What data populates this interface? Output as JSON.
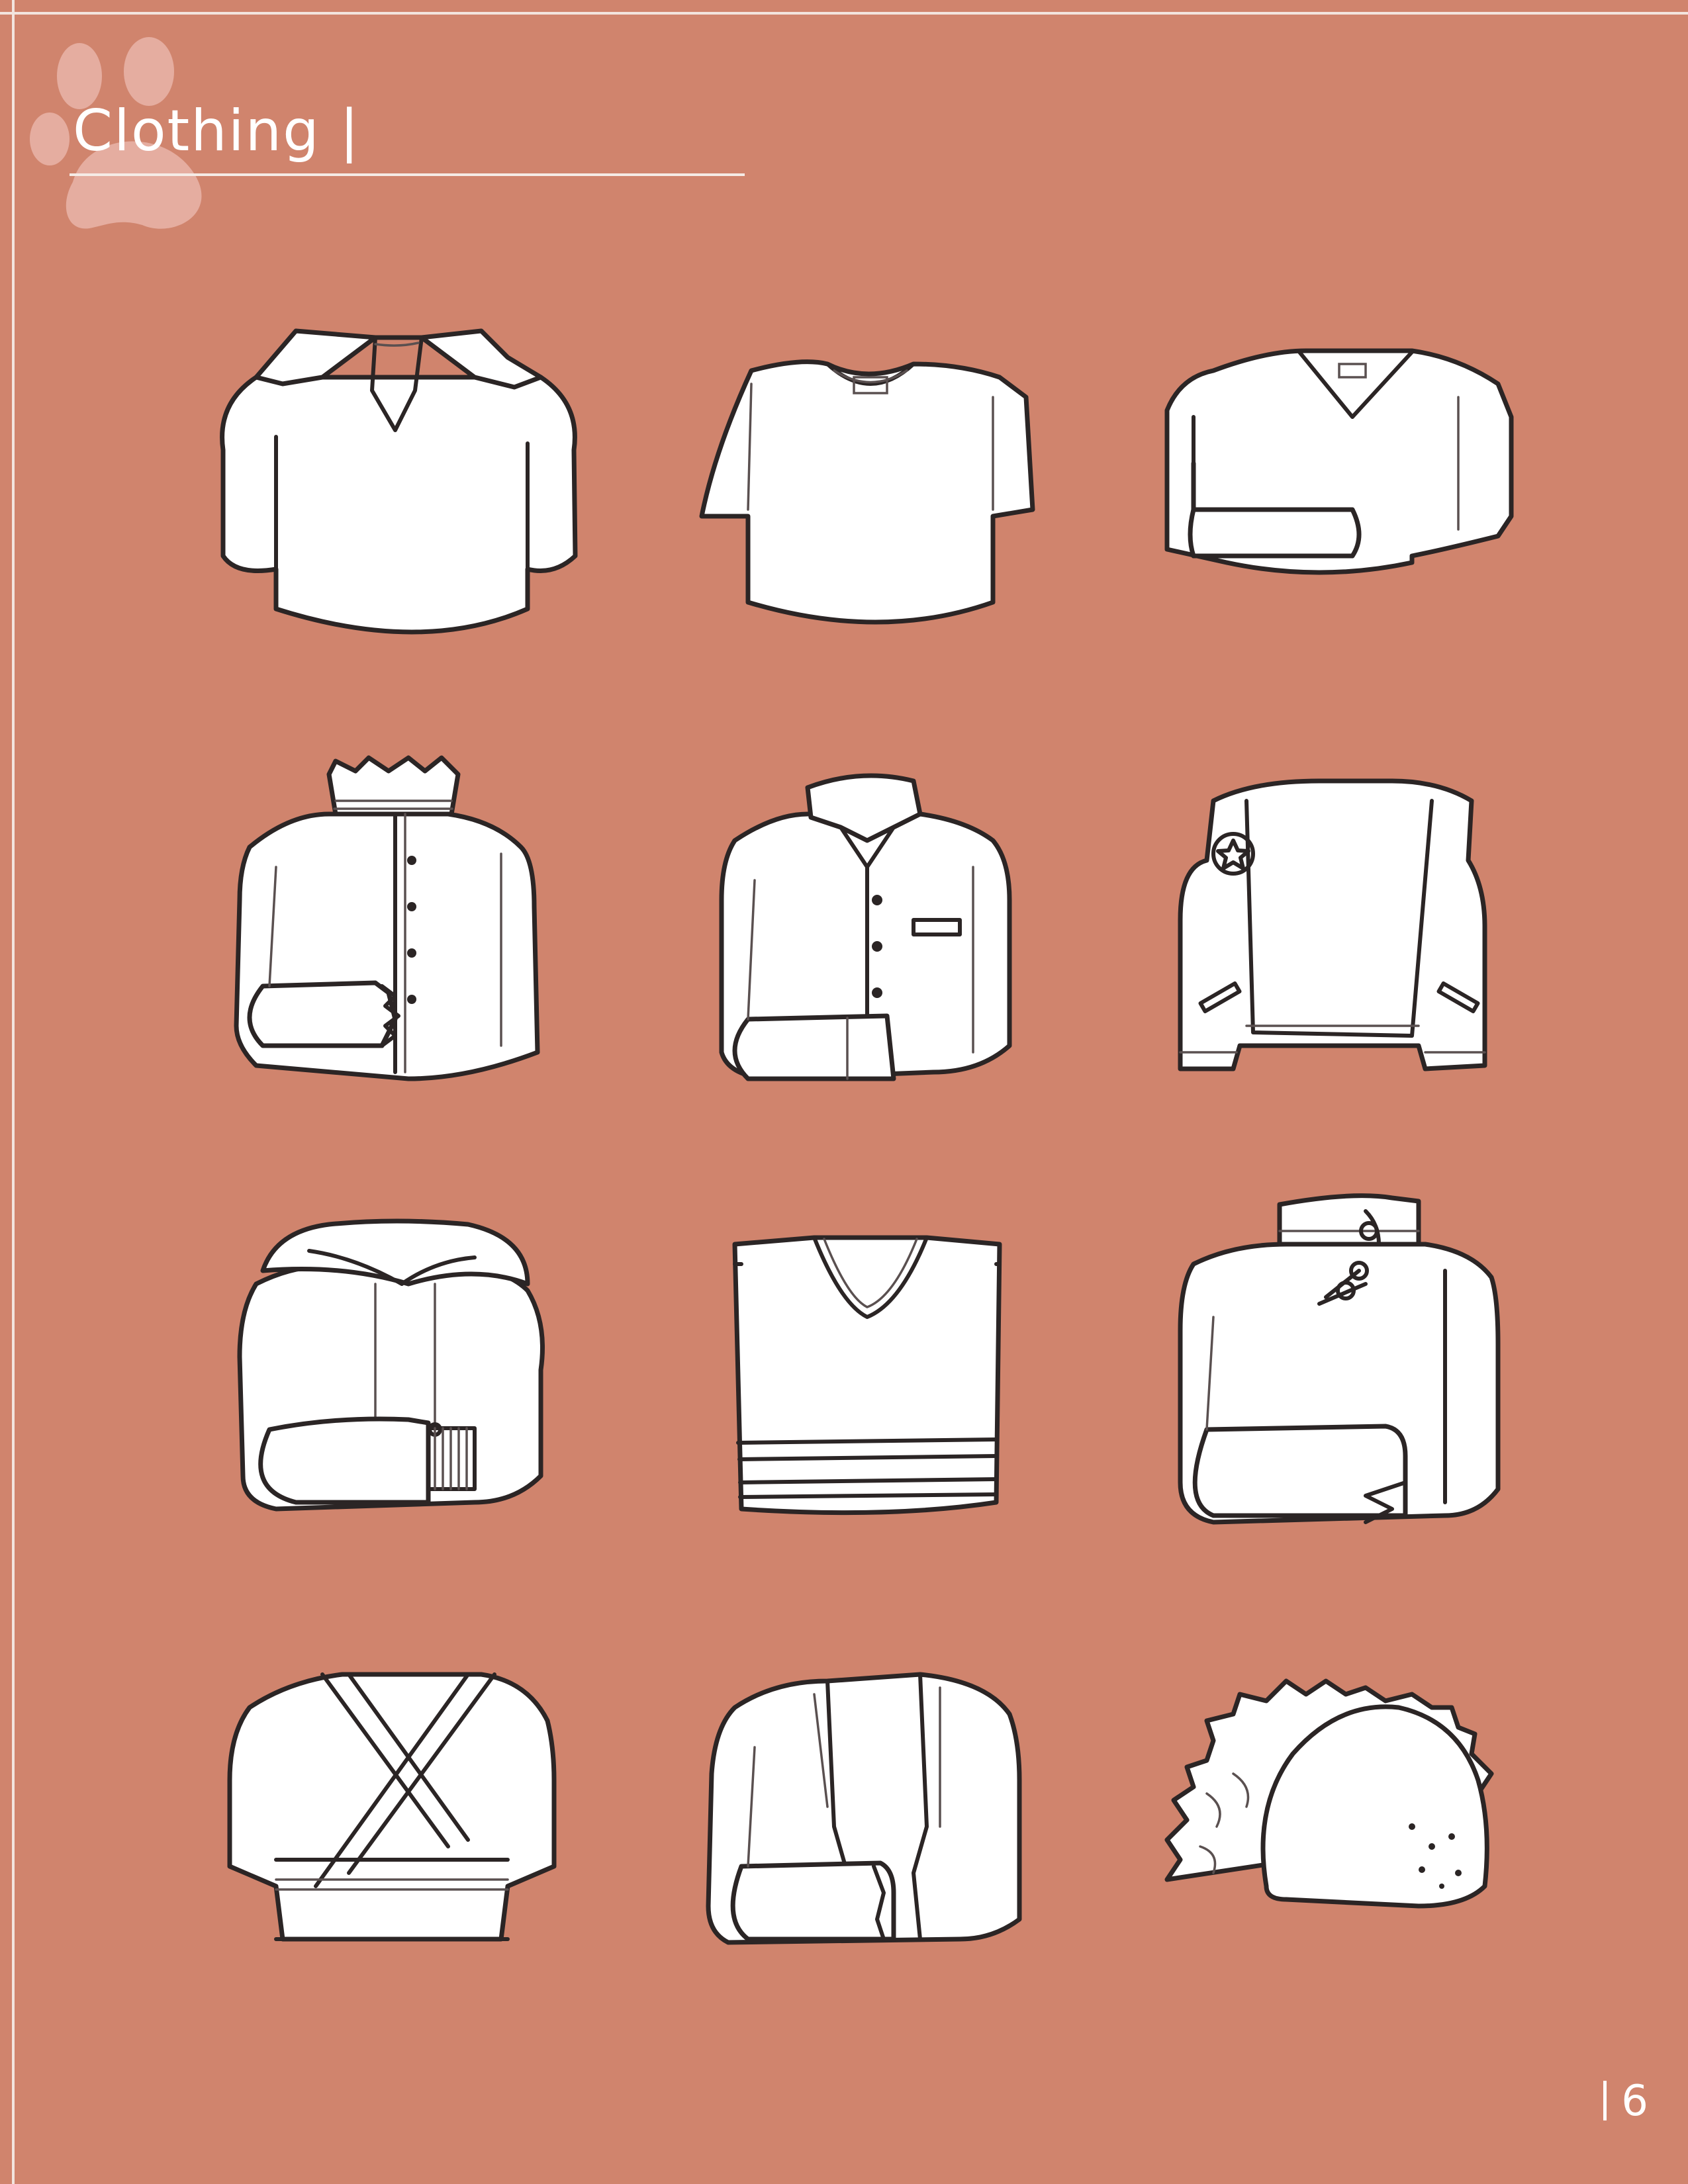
{
  "page": {
    "title": "Clothing",
    "title_separator": "|",
    "page_number": "6",
    "colors": {
      "background": "#d0846d",
      "garment_fill": "#ffffff",
      "line": "#2b2525",
      "accent": "#f5ebe6"
    }
  },
  "icons": [
    "paw-print-icon"
  ],
  "garments": [
    {
      "row": 1,
      "col": 1,
      "icon": "polo-shirt-icon"
    },
    {
      "row": 1,
      "col": 2,
      "icon": "t-shirt-icon"
    },
    {
      "row": 1,
      "col": 3,
      "icon": "v-neck-sweater-icon"
    },
    {
      "row": 2,
      "col": 1,
      "icon": "ruffle-collar-cardigan-icon"
    },
    {
      "row": 2,
      "col": 2,
      "icon": "button-up-shirt-icon"
    },
    {
      "row": 2,
      "col": 3,
      "icon": "open-vest-icon"
    },
    {
      "row": 3,
      "col": 1,
      "icon": "hoodie-icon"
    },
    {
      "row": 3,
      "col": 2,
      "icon": "v-neck-sweater-vest-icon"
    },
    {
      "row": 3,
      "col": 3,
      "icon": "mandarin-collar-jacket-icon"
    },
    {
      "row": 4,
      "col": 1,
      "icon": "wrap-top-icon"
    },
    {
      "row": 4,
      "col": 2,
      "icon": "open-cardigan-icon"
    },
    {
      "row": 4,
      "col": 3,
      "icon": "taco-icon"
    }
  ]
}
